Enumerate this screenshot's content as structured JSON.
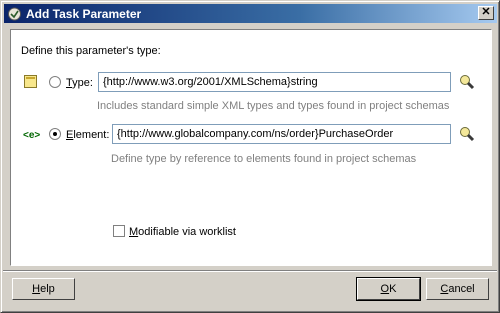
{
  "window": {
    "title": "Add Task Parameter",
    "close_glyph": "✕"
  },
  "main": {
    "heading": "Define this parameter's type:",
    "type_option": {
      "label_mnemonic": "T",
      "label_rest": "ype:",
      "value": "{http://www.w3.org/2001/XMLSchema}string",
      "hint": "Includes standard simple XML types and types found in project schemas",
      "icon": "xsd-type-icon",
      "browse_icon": "flashlight-icon"
    },
    "element_option": {
      "label_mnemonic": "E",
      "label_rest": "lement:",
      "value": "{http://www.globalcompany.com/ns/order}PurchaseOrder",
      "hint": "Define type by reference to elements found in project schemas",
      "icon": "xml-element-icon",
      "icon_text": "<e>",
      "browse_icon": "flashlight-icon"
    },
    "modifiable": {
      "label_mnemonic": "M",
      "label_rest": "odifiable via worklist",
      "checked": false
    }
  },
  "footer": {
    "help": {
      "mnemonic": "H",
      "rest": "elp"
    },
    "ok": {
      "mnemonic": "O",
      "rest": "K"
    },
    "cancel": {
      "mnemonic": "C",
      "rest": "ancel"
    }
  }
}
